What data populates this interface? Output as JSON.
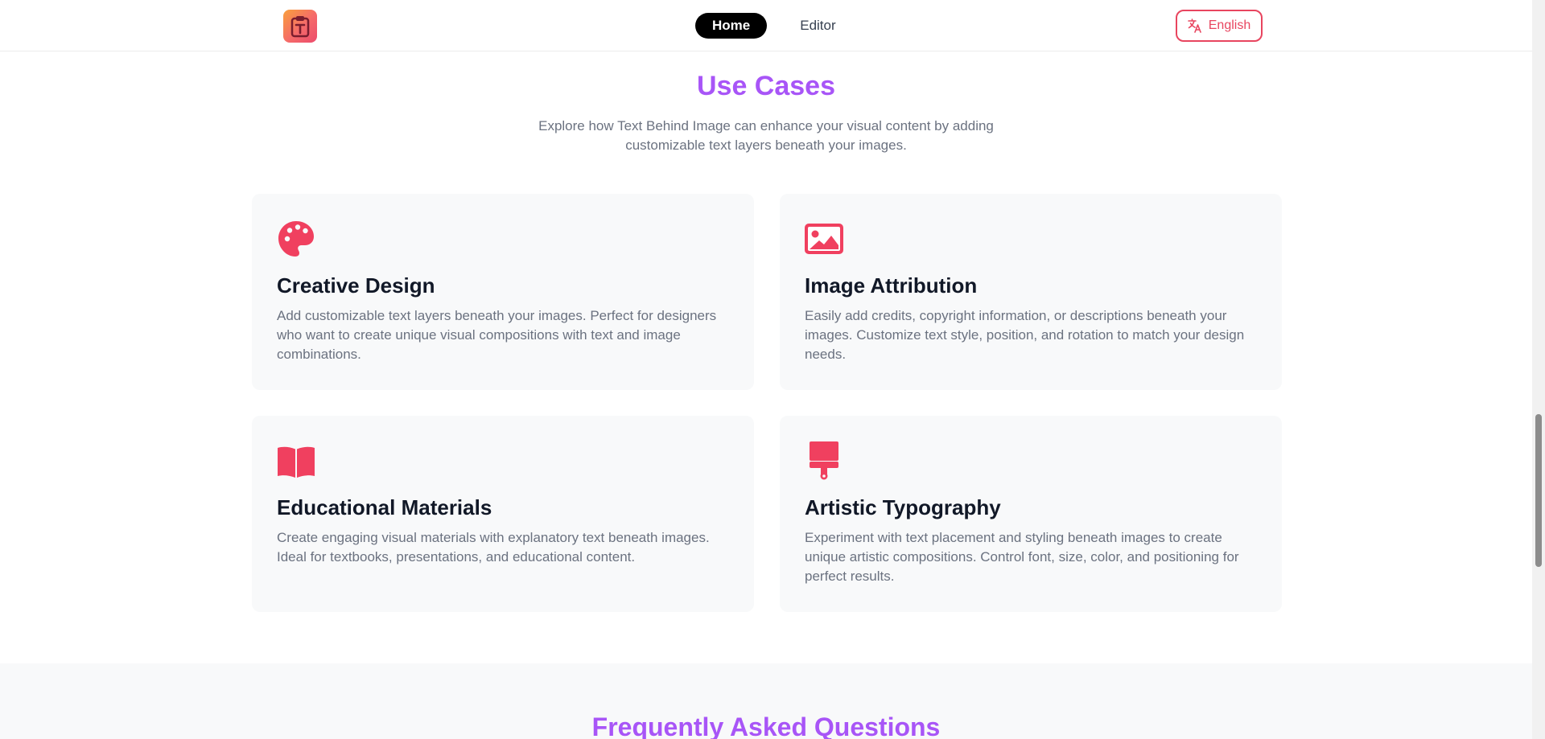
{
  "header": {
    "logo_icon": "text-document-icon",
    "nav": [
      {
        "label": "Home",
        "active": true
      },
      {
        "label": "Editor",
        "active": false
      }
    ],
    "language_button": {
      "label": "English",
      "icon": "translate-icon"
    }
  },
  "use_cases": {
    "title": "Use Cases",
    "description": "Explore how Text Behind Image can enhance your visual content by adding customizable text layers beneath your images.",
    "cards": [
      {
        "icon": "palette-icon",
        "title": "Creative Design",
        "description": "Add customizable text layers beneath your images. Perfect for designers who want to create unique visual compositions with text and image combinations."
      },
      {
        "icon": "image-icon",
        "title": "Image Attribution",
        "description": "Easily add credits, copyright information, or descriptions beneath your images. Customize text style, position, and rotation to match your design needs."
      },
      {
        "icon": "book-icon",
        "title": "Educational Materials",
        "description": "Create engaging visual materials with explanatory text beneath images. Ideal for textbooks, presentations, and educational content."
      },
      {
        "icon": "paint-brush-icon",
        "title": "Artistic Typography",
        "description": "Experiment with text placement and styling beneath images to create unique artistic compositions. Control font, size, color, and positioning for perfect results."
      }
    ]
  },
  "faq": {
    "title": "Frequently Asked Questions"
  },
  "colors": {
    "accent_purple": "#a855f7",
    "accent_red": "#f0405f",
    "card_bg": "#f8f9fa",
    "muted_text": "#6b7280"
  }
}
